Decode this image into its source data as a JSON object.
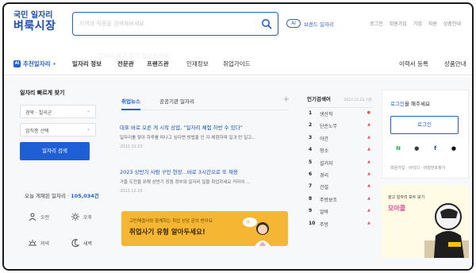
{
  "header": {
    "logo_line1": "국민 일자리",
    "logo_line2": "벼룩시장",
    "search_placeholder": "지역과 직종을 검색해보세요",
    "ai_badge": "AI",
    "voice_label": "브랜드 일자리",
    "top_links": [
      "로그인",
      "회원가입",
      "기업",
      "지원",
      "상품안내"
    ]
  },
  "nav": {
    "recommend_label": "추천일자리",
    "recommend_sup": "+",
    "faded_text": "일자리 찾기 추가 합성하세요",
    "items": [
      "일자리 정보",
      "전문관",
      "프랜즈관",
      "인재정보",
      "취업가이드"
    ],
    "right_items": [
      "이력서 등록",
      "상품안내"
    ]
  },
  "left": {
    "title": "일자리 빠르게 찾기",
    "region": "경북 · 칠곡군",
    "category": "업직종 선택",
    "search_button": "일자리 검색",
    "count_prefix": "오늘 게재된 일자리 · ",
    "count_value": "105,034건",
    "times": [
      "오전",
      "오후",
      "저녁",
      "새벽"
    ]
  },
  "middle": {
    "tabs": [
      "취업뉴스",
      "공공기관 일자리"
    ],
    "news": [
      {
        "headline": "대표 바로 오른 게 시작 상업, “일자리 체험 하반 수 있다”",
        "body": "일자리를 찾아 하루를 떠나고 싶다면 방법을 인 지-체험하며 일과 만 일고...",
        "date": "2022.12.23"
      },
      {
        "headline": "2023 상반기 사람 구인 현장...바로 3시간으로 또 재용",
        "body": "가을 도전을 위해 상반기 장점 정부와 일자리 일을 취업하세요 커리어 ...",
        "date": "2022.12.20"
      }
    ],
    "banner_small": "고민해결사와 함께하는 취업 상담 문의 받아요",
    "banner_big": "취업사기 유형 알아두세요!"
  },
  "ranking": {
    "title": "인기검색어",
    "date": "2022.12.23 기준",
    "items": [
      {
        "rank": "1",
        "word": "생산직",
        "mark": "●"
      },
      {
        "rank": "2",
        "word": "단순노무",
        "mark": "▲"
      },
      {
        "rank": "3",
        "word": "야간",
        "mark": "▲"
      },
      {
        "rank": "4",
        "word": "청소",
        "mark": "▲"
      },
      {
        "rank": "5",
        "word": "설거지",
        "mark": "▲"
      },
      {
        "rank": "6",
        "word": "경리",
        "mark": "▲"
      },
      {
        "rank": "7",
        "word": "건설",
        "mark": "▲"
      },
      {
        "rank": "8",
        "word": "주방보조",
        "mark": "▲"
      },
      {
        "rank": "9",
        "word": "알바",
        "mark": "▲"
      },
      {
        "rank": "10",
        "word": "주방",
        "mark": "▲"
      }
    ]
  },
  "login": {
    "title_highlight": "로그인",
    "title_rest": "을 해주세요",
    "button": "로그인",
    "socials": [
      "N",
      "●",
      "f",
      "●"
    ],
    "links": "회원가입 · 아이디 · 비밀번호찾기",
    "ad_small": "광고 일자리 모두 보기",
    "ad_big": "모아콜"
  },
  "colors": {
    "accent": "#1f5fd6",
    "banner": "#f5b733",
    "ad_pink": "#e84ca0"
  }
}
